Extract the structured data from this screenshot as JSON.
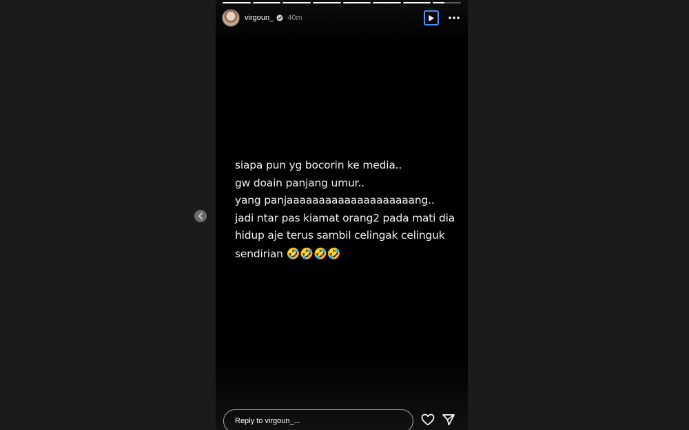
{
  "story": {
    "username": "virgoun_",
    "time": "40m",
    "progress": [
      1,
      1,
      1,
      1,
      1,
      1,
      1,
      0.4
    ],
    "lines": [
      "siapa pun yg bocorin ke media..",
      "gw doain panjang umur..",
      "yang panjaaaaaaaaaaaaaaaaaaaang..",
      "jadi ntar pas kiamat orang2 pada mati dia",
      "hidup aje terus sambil celingak celinguk",
      "sendirian"
    ],
    "emoji": "🤣🤣🤣🤣"
  },
  "reply": {
    "placeholder": "Reply to virgoun_..."
  },
  "icons": {
    "verified": "verified-badge-icon",
    "play": "play-icon",
    "more": "more-options-icon",
    "heart": "heart-icon",
    "share": "send-icon",
    "prev": "chevron-left-icon"
  },
  "colors": {
    "background": "#1b1b1b",
    "story": "#000000",
    "focus": "#4d8dff"
  }
}
